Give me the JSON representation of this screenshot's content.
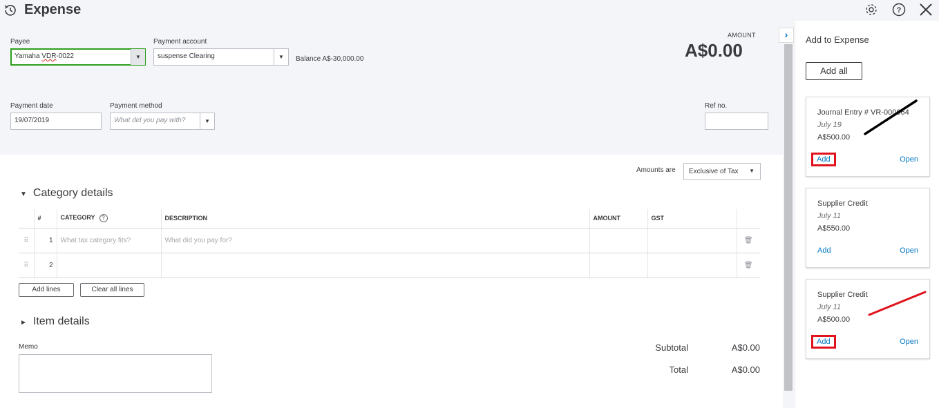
{
  "header": {
    "title": "Expense",
    "history_icon": "history-clock-icon",
    "gear_icon": "gear-icon",
    "help_icon": "help-icon",
    "close_icon": "close-icon"
  },
  "form": {
    "payee_label": "Payee",
    "payee_value": "Yamaha VDR-0022",
    "payee_prefix": "Yamaha ",
    "payee_spell": "VDR",
    "payee_suffix": "-0022",
    "payment_account_label": "Payment account",
    "payment_account_value": "suspense Clearing",
    "balance_text": "Balance A$-30,000.00",
    "amount_label": "AMOUNT",
    "amount_value": "A$0.00",
    "payment_date_label": "Payment date",
    "payment_date_value": "19/07/2019",
    "payment_method_label": "Payment method",
    "payment_method_placeholder": "What did you pay with?",
    "ref_no_label": "Ref no.",
    "ref_no_value": ""
  },
  "amounts_are": {
    "label": "Amounts are",
    "value": "Exclusive of Tax"
  },
  "category_details": {
    "title": "Category details",
    "columns": [
      "#",
      "CATEGORY",
      "DESCRIPTION",
      "AMOUNT",
      "GST"
    ],
    "rows": [
      {
        "num": "1",
        "category_placeholder": "What tax category fits?",
        "description_placeholder": "What did you pay for?"
      },
      {
        "num": "2",
        "category_placeholder": "",
        "description_placeholder": ""
      }
    ],
    "add_lines_label": "Add lines",
    "clear_lines_label": "Clear all lines"
  },
  "item_details": {
    "title": "Item details"
  },
  "memo": {
    "label": "Memo"
  },
  "totals": {
    "subtotal_label": "Subtotal",
    "subtotal_value": "A$0.00",
    "total_label": "Total",
    "total_value": "A$0.00"
  },
  "sidebar": {
    "title": "Add to Expense",
    "add_all_label": "Add all",
    "cards": [
      {
        "title": "Journal Entry # VR-000064",
        "date": "July 19",
        "amount": "A$500.00",
        "add": "Add",
        "open": "Open",
        "annotation_color": "#000000"
      },
      {
        "title": "Supplier Credit",
        "date": "July 11",
        "amount": "A$550.00",
        "add": "Add",
        "open": "Open"
      },
      {
        "title": "Supplier Credit",
        "date": "July 11",
        "amount": "A$500.00",
        "add": "Add",
        "open": "Open",
        "annotation_color": "#e0121b"
      }
    ]
  },
  "colors": {
    "accent_blue": "#0077c5",
    "active_green": "#2ca01c",
    "highlight_red": "#e0121b",
    "header_bg": "#f4f5f8"
  }
}
